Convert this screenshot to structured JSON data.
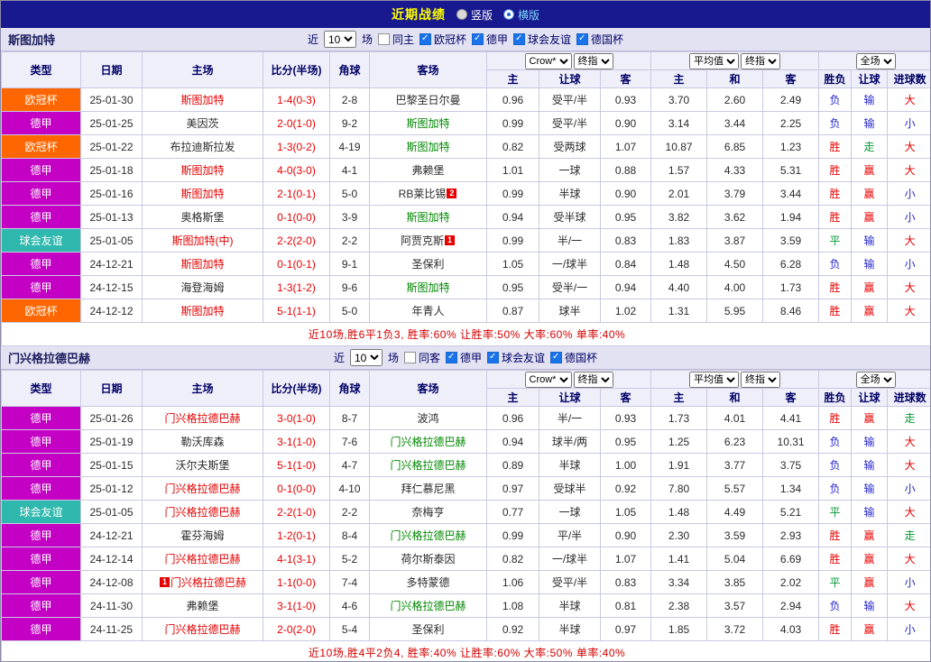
{
  "top_bar": {
    "title": "近期战绩",
    "view_options": [
      {
        "label": "竖版",
        "selected": false
      },
      {
        "label": "横版",
        "selected": true
      }
    ]
  },
  "table_headers": {
    "left": [
      "类型",
      "日期",
      "主场",
      "比分(半场)",
      "角球",
      "客场"
    ],
    "bookmaker_selects": [
      "Crow*",
      "终指"
    ],
    "average_selects": [
      "平均值",
      "终指"
    ],
    "scope_select": "全场",
    "sub": [
      "主",
      "让球",
      "客",
      "主",
      "和",
      "客",
      "胜负",
      "让球",
      "进球数"
    ]
  },
  "sections": [
    {
      "team": "斯图加特",
      "filters": {
        "prefix": "近",
        "count": "10",
        "suffix": "场",
        "same": {
          "label": "同主",
          "checked": false
        },
        "competitions": [
          {
            "label": "欧冠杯",
            "checked": true
          },
          {
            "label": "德甲",
            "checked": true
          },
          {
            "label": "球会友谊",
            "checked": true
          },
          {
            "label": "德国杯",
            "checked": true
          }
        ]
      },
      "rows": [
        {
          "comp": "欧冠杯",
          "date": "25-01-30",
          "home": {
            "name": "斯图加特",
            "cls": "red"
          },
          "score": "1-4(0-3)",
          "corner": "2-8",
          "away": {
            "name": "巴黎圣日尔曼",
            "cls": "plain"
          },
          "odds": [
            "0.96",
            "受平/半",
            "0.93"
          ],
          "avg": [
            "3.70",
            "2.60",
            "2.49"
          ],
          "result": [
            "负",
            "输",
            "大"
          ]
        },
        {
          "comp": "德甲",
          "date": "25-01-25",
          "home": {
            "name": "美因茨",
            "cls": "plain"
          },
          "score": "2-0(1-0)",
          "corner": "9-2",
          "away": {
            "name": "斯图加特",
            "cls": "green"
          },
          "odds": [
            "0.99",
            "受平/半",
            "0.90"
          ],
          "avg": [
            "3.14",
            "3.44",
            "2.25"
          ],
          "result": [
            "负",
            "输",
            "小"
          ]
        },
        {
          "comp": "欧冠杯",
          "date": "25-01-22",
          "home": {
            "name": "布拉迪斯拉发",
            "cls": "plain"
          },
          "score": "1-3(0-2)",
          "corner": "4-19",
          "away": {
            "name": "斯图加特",
            "cls": "green"
          },
          "odds": [
            "0.82",
            "受两球",
            "1.07"
          ],
          "avg": [
            "10.87",
            "6.85",
            "1.23"
          ],
          "result": [
            "胜",
            "走",
            "大"
          ]
        },
        {
          "comp": "德甲",
          "date": "25-01-18",
          "home": {
            "name": "斯图加特",
            "cls": "red"
          },
          "score": "4-0(3-0)",
          "corner": "4-1",
          "away": {
            "name": "弗赖堡",
            "cls": "plain"
          },
          "odds": [
            "1.01",
            "一球",
            "0.88"
          ],
          "avg": [
            "1.57",
            "4.33",
            "5.31"
          ],
          "result": [
            "胜",
            "赢",
            "大"
          ]
        },
        {
          "comp": "德甲",
          "date": "25-01-16",
          "home": {
            "name": "斯图加特",
            "cls": "red"
          },
          "score": "2-1(0-1)",
          "corner": "5-0",
          "away": {
            "name": "RB莱比锡",
            "cls": "plain",
            "badge": "2"
          },
          "odds": [
            "0.99",
            "半球",
            "0.90"
          ],
          "avg": [
            "2.01",
            "3.79",
            "3.44"
          ],
          "result": [
            "胜",
            "赢",
            "小"
          ]
        },
        {
          "comp": "德甲",
          "date": "25-01-13",
          "home": {
            "name": "奥格斯堡",
            "cls": "plain"
          },
          "score": "0-1(0-0)",
          "corner": "3-9",
          "away": {
            "name": "斯图加特",
            "cls": "green"
          },
          "odds": [
            "0.94",
            "受半球",
            "0.95"
          ],
          "avg": [
            "3.82",
            "3.62",
            "1.94"
          ],
          "result": [
            "胜",
            "赢",
            "小"
          ]
        },
        {
          "comp": "球会友谊",
          "date": "25-01-05",
          "home": {
            "name": "斯图加特(中)",
            "cls": "red"
          },
          "score": "2-2(2-0)",
          "corner": "2-2",
          "away": {
            "name": "阿贾克斯",
            "cls": "plain",
            "badge": "1"
          },
          "odds": [
            "0.99",
            "半/一",
            "0.83"
          ],
          "avg": [
            "1.83",
            "3.87",
            "3.59"
          ],
          "result": [
            "平",
            "输",
            "大"
          ]
        },
        {
          "comp": "德甲",
          "date": "24-12-21",
          "home": {
            "name": "斯图加特",
            "cls": "red"
          },
          "score": "0-1(0-1)",
          "corner": "9-1",
          "away": {
            "name": "圣保利",
            "cls": "plain"
          },
          "odds": [
            "1.05",
            "一/球半",
            "0.84"
          ],
          "avg": [
            "1.48",
            "4.50",
            "6.28"
          ],
          "result": [
            "负",
            "输",
            "小"
          ]
        },
        {
          "comp": "德甲",
          "date": "24-12-15",
          "home": {
            "name": "海登海姆",
            "cls": "plain"
          },
          "score": "1-3(1-2)",
          "corner": "9-6",
          "away": {
            "name": "斯图加特",
            "cls": "green"
          },
          "odds": [
            "0.95",
            "受半/一",
            "0.94"
          ],
          "avg": [
            "4.40",
            "4.00",
            "1.73"
          ],
          "result": [
            "胜",
            "赢",
            "大"
          ]
        },
        {
          "comp": "欧冠杯",
          "date": "24-12-12",
          "home": {
            "name": "斯图加特",
            "cls": "red"
          },
          "score": "5-1(1-1)",
          "corner": "5-0",
          "away": {
            "name": "年青人",
            "cls": "plain"
          },
          "odds": [
            "0.87",
            "球半",
            "1.02"
          ],
          "avg": [
            "1.31",
            "5.95",
            "8.46"
          ],
          "result": [
            "胜",
            "赢",
            "大"
          ]
        }
      ],
      "summary": "近10场,胜6平1负3, 胜率:60% 让胜率:50% 大率:60% 单率:40%"
    },
    {
      "team": "门兴格拉德巴赫",
      "filters": {
        "prefix": "近",
        "count": "10",
        "suffix": "场",
        "same": {
          "label": "同客",
          "checked": false
        },
        "competitions": [
          {
            "label": "德甲",
            "checked": true
          },
          {
            "label": "球会友谊",
            "checked": true
          },
          {
            "label": "德国杯",
            "checked": true
          }
        ]
      },
      "rows": [
        {
          "comp": "德甲",
          "date": "25-01-26",
          "home": {
            "name": "门兴格拉德巴赫",
            "cls": "red"
          },
          "score": "3-0(1-0)",
          "corner": "8-7",
          "away": {
            "name": "波鸿",
            "cls": "plain"
          },
          "odds": [
            "0.96",
            "半/一",
            "0.93"
          ],
          "avg": [
            "1.73",
            "4.01",
            "4.41"
          ],
          "result": [
            "胜",
            "赢",
            "走"
          ]
        },
        {
          "comp": "德甲",
          "date": "25-01-19",
          "home": {
            "name": "勒沃库森",
            "cls": "plain"
          },
          "score": "3-1(1-0)",
          "corner": "7-6",
          "away": {
            "name": "门兴格拉德巴赫",
            "cls": "green"
          },
          "odds": [
            "0.94",
            "球半/两",
            "0.95"
          ],
          "avg": [
            "1.25",
            "6.23",
            "10.31"
          ],
          "result": [
            "负",
            "输",
            "大"
          ]
        },
        {
          "comp": "德甲",
          "date": "25-01-15",
          "home": {
            "name": "沃尔夫斯堡",
            "cls": "plain"
          },
          "score": "5-1(1-0)",
          "corner": "4-7",
          "away": {
            "name": "门兴格拉德巴赫",
            "cls": "green"
          },
          "odds": [
            "0.89",
            "半球",
            "1.00"
          ],
          "avg": [
            "1.91",
            "3.77",
            "3.75"
          ],
          "result": [
            "负",
            "输",
            "大"
          ]
        },
        {
          "comp": "德甲",
          "date": "25-01-12",
          "home": {
            "name": "门兴格拉德巴赫",
            "cls": "red"
          },
          "score": "0-1(0-0)",
          "corner": "4-10",
          "away": {
            "name": "拜仁慕尼黑",
            "cls": "plain"
          },
          "odds": [
            "0.97",
            "受球半",
            "0.92"
          ],
          "avg": [
            "7.80",
            "5.57",
            "1.34"
          ],
          "result": [
            "负",
            "输",
            "小"
          ]
        },
        {
          "comp": "球会友谊",
          "date": "25-01-05",
          "home": {
            "name": "门兴格拉德巴赫",
            "cls": "red"
          },
          "score": "2-2(1-0)",
          "corner": "2-2",
          "away": {
            "name": "奈梅亨",
            "cls": "plain"
          },
          "odds": [
            "0.77",
            "一球",
            "1.05"
          ],
          "avg": [
            "1.48",
            "4.49",
            "5.21"
          ],
          "result": [
            "平",
            "输",
            "大"
          ]
        },
        {
          "comp": "德甲",
          "date": "24-12-21",
          "home": {
            "name": "霍芬海姆",
            "cls": "plain"
          },
          "score": "1-2(0-1)",
          "corner": "8-4",
          "away": {
            "name": "门兴格拉德巴赫",
            "cls": "green"
          },
          "odds": [
            "0.99",
            "平/半",
            "0.90"
          ],
          "avg": [
            "2.30",
            "3.59",
            "2.93"
          ],
          "result": [
            "胜",
            "赢",
            "走"
          ]
        },
        {
          "comp": "德甲",
          "date": "24-12-14",
          "home": {
            "name": "门兴格拉德巴赫",
            "cls": "red"
          },
          "score": "4-1(3-1)",
          "corner": "5-2",
          "away": {
            "name": "荷尔斯泰因",
            "cls": "plain"
          },
          "odds": [
            "0.82",
            "一/球半",
            "1.07"
          ],
          "avg": [
            "1.41",
            "5.04",
            "6.69"
          ],
          "result": [
            "胜",
            "赢",
            "大"
          ]
        },
        {
          "comp": "德甲",
          "date": "24-12-08",
          "home": {
            "name": "门兴格拉德巴赫",
            "cls": "red",
            "badge": "1",
            "badge_pos": "before"
          },
          "score": "1-1(0-0)",
          "corner": "7-4",
          "away": {
            "name": "多特蒙德",
            "cls": "plain"
          },
          "odds": [
            "1.06",
            "受平/半",
            "0.83"
          ],
          "avg": [
            "3.34",
            "3.85",
            "2.02"
          ],
          "result": [
            "平",
            "赢",
            "小"
          ]
        },
        {
          "comp": "德甲",
          "date": "24-11-30",
          "home": {
            "name": "弗赖堡",
            "cls": "plain"
          },
          "score": "3-1(1-0)",
          "corner": "4-6",
          "away": {
            "name": "门兴格拉德巴赫",
            "cls": "green"
          },
          "odds": [
            "1.08",
            "半球",
            "0.81"
          ],
          "avg": [
            "2.38",
            "3.57",
            "2.94"
          ],
          "result": [
            "负",
            "输",
            "大"
          ]
        },
        {
          "comp": "德甲",
          "date": "24-11-25",
          "home": {
            "name": "门兴格拉德巴赫",
            "cls": "red"
          },
          "score": "2-0(2-0)",
          "corner": "5-4",
          "away": {
            "name": "圣保利",
            "cls": "plain"
          },
          "odds": [
            "0.92",
            "半球",
            "0.97"
          ],
          "avg": [
            "1.85",
            "3.72",
            "4.03"
          ],
          "result": [
            "胜",
            "赢",
            "小"
          ]
        }
      ],
      "summary": "近10场,胜4平2负4, 胜率:40% 让胜率:60% 大率:50% 单率:40%"
    }
  ]
}
